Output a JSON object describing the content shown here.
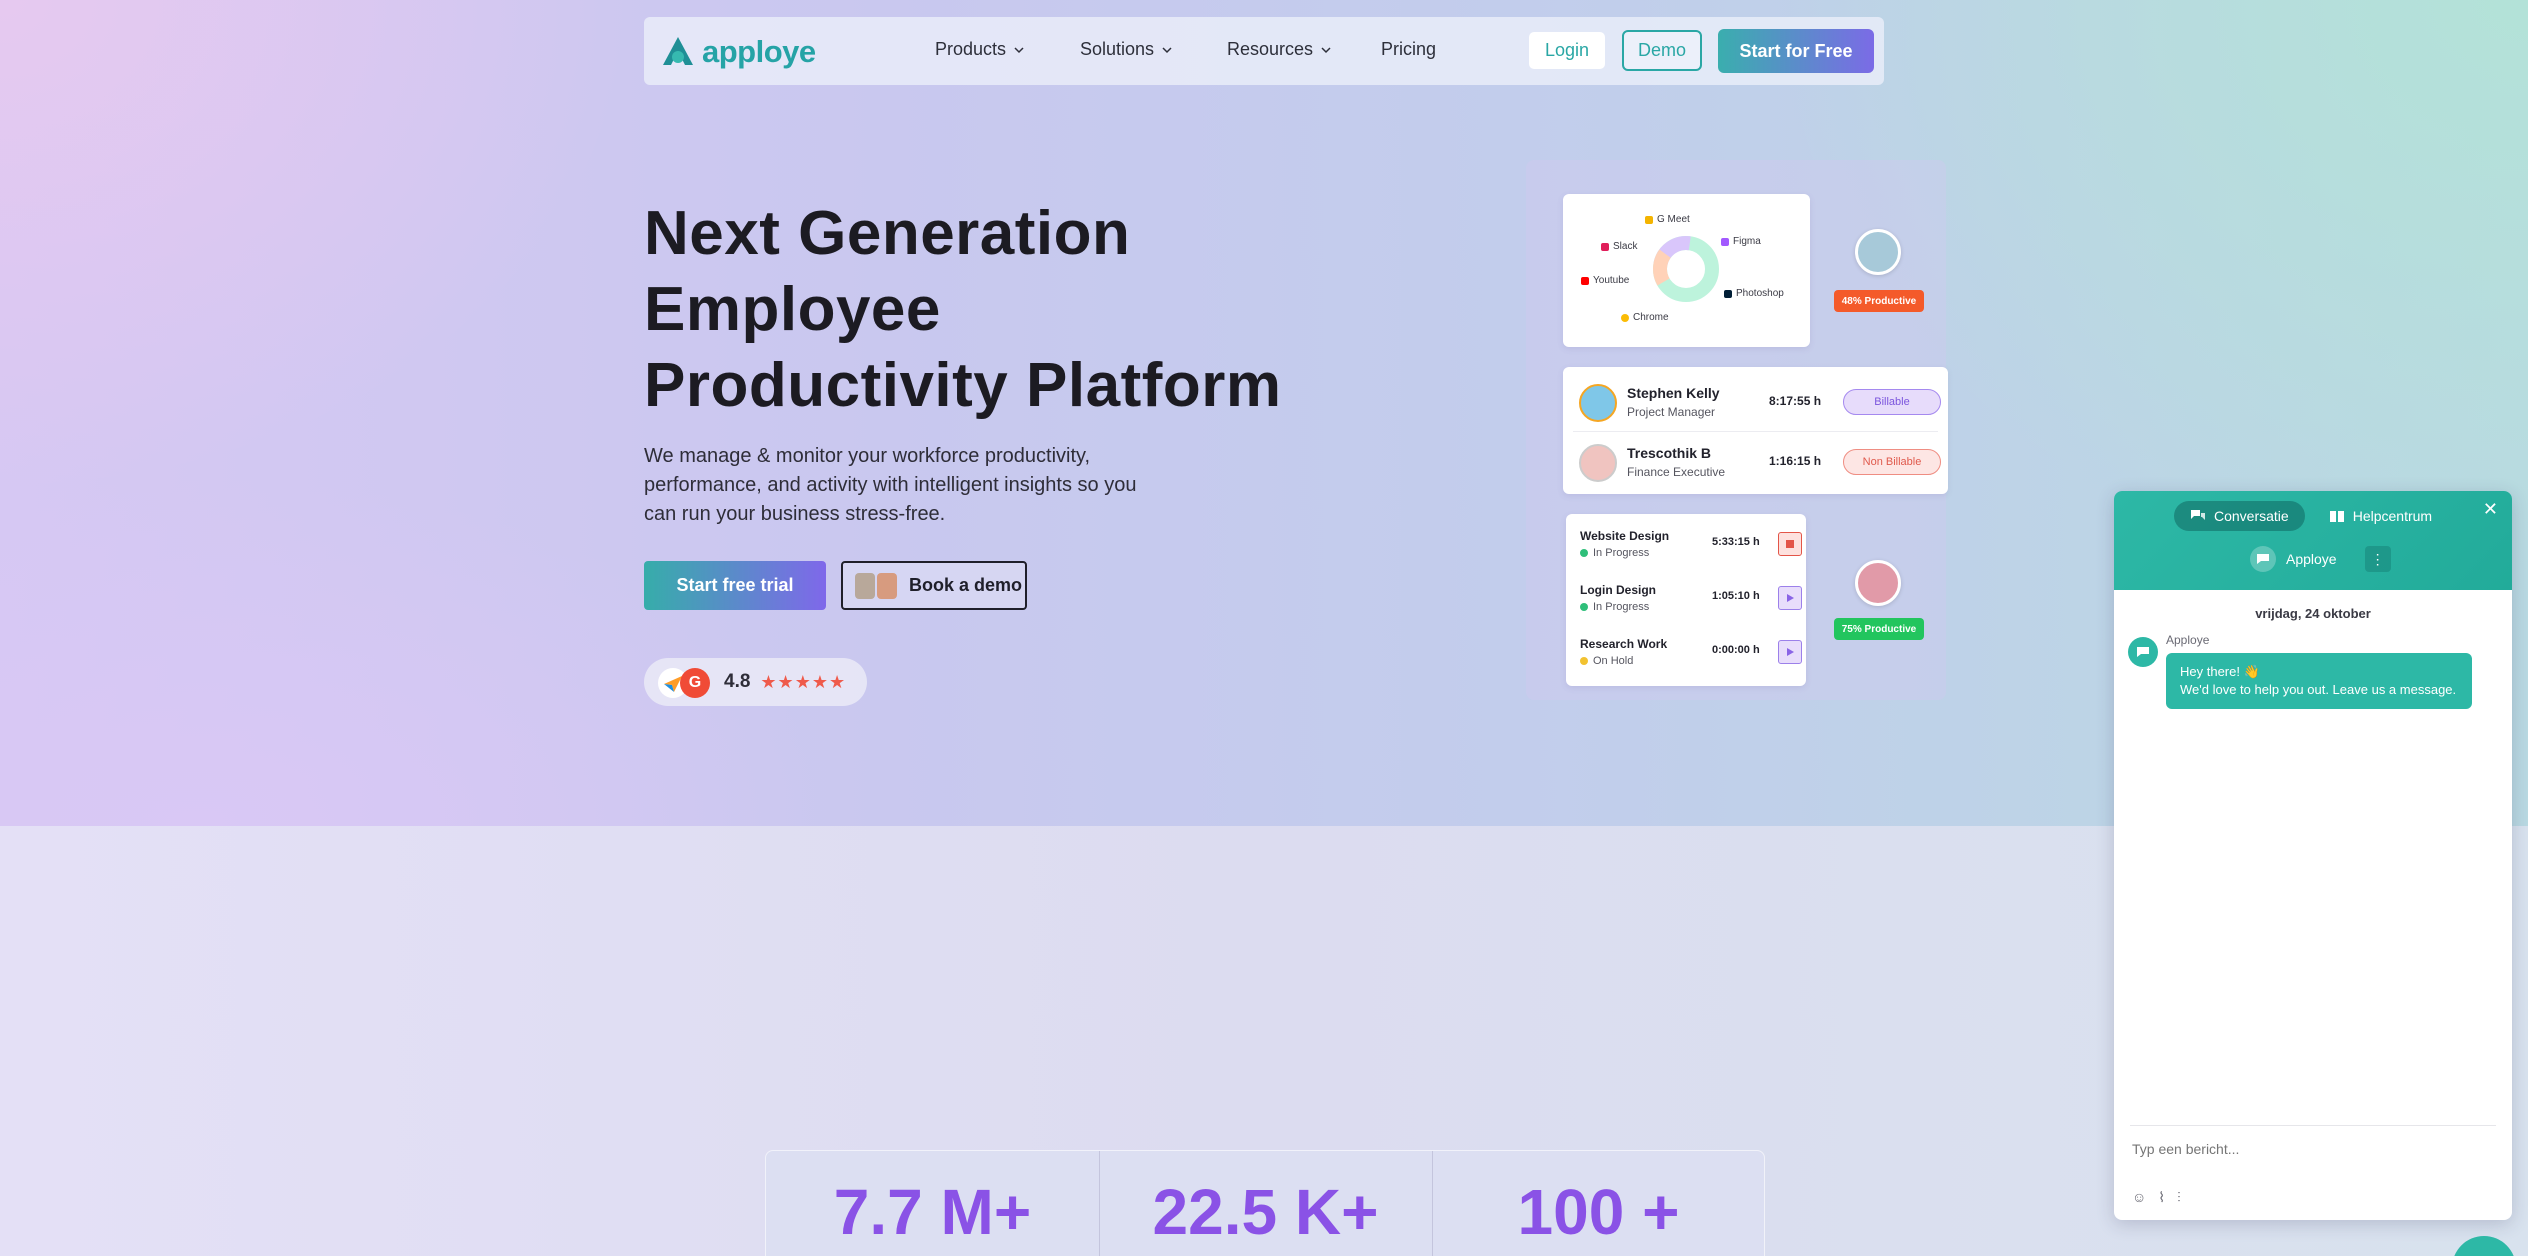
{
  "nav": {
    "logo_text": "apploye",
    "items": [
      {
        "label": "Products",
        "has_dropdown": true
      },
      {
        "label": "Solutions",
        "has_dropdown": true
      },
      {
        "label": "Resources",
        "has_dropdown": true
      },
      {
        "label": "Pricing",
        "has_dropdown": false
      }
    ],
    "login_label": "Login",
    "demo_label": "Demo",
    "start_label": "Start for Free"
  },
  "hero": {
    "title_line1": "Next Generation",
    "title_line2": "Employee",
    "title_line3": "Productivity Platform",
    "subtitle": "We manage & monitor your workforce productivity, performance, and activity with intelligent insights so you can run your business stress-free.",
    "trial_label": "Start free trial",
    "demo_label": "Book a demo",
    "rating_value": "4.8",
    "rating_stars": "★★★★★"
  },
  "apps_card": {
    "apps": [
      {
        "name": "G Meet",
        "color": "#f4b400"
      },
      {
        "name": "Figma",
        "color": "#a259ff"
      },
      {
        "name": "Slack",
        "color": "#e01e5a"
      },
      {
        "name": "Youtube",
        "color": "#ff0000"
      },
      {
        "name": "Photoshop",
        "color": "#001e36"
      },
      {
        "name": "Chrome",
        "color": "#fbbc05"
      }
    ],
    "productive_badge_1": "48% Productive",
    "productive_badge_2": "75% Productive"
  },
  "people": [
    {
      "name": "Stephen Kelly",
      "role": "Project Manager",
      "time": "8:17:55 h",
      "tag": "Billable"
    },
    {
      "name": "Trescothik B",
      "role": "Finance Executive",
      "time": "1:16:15 h",
      "tag": "Non Billable"
    }
  ],
  "tasks": [
    {
      "name": "Website Design",
      "status": "In Progress",
      "status_color": "#2fbf7a",
      "time": "5:33:15 h",
      "state": "stop"
    },
    {
      "name": "Login Design",
      "status": "In Progress",
      "status_color": "#2fbf7a",
      "time": "1:05:10 h",
      "state": "play"
    },
    {
      "name": "Research Work",
      "status": "On Hold",
      "status_color": "#f2c230",
      "time": "0:00:00 h",
      "state": "play"
    }
  ],
  "stats": [
    "7.7 M+",
    "22.5 K+",
    "100 +"
  ],
  "chat": {
    "tab_conversation": "Conversatie",
    "tab_help": "Helpcentrum",
    "agent_name": "Apploye",
    "date": "vrijdag, 24 oktober",
    "sender": "Apploye",
    "message_line1": "Hey there! 👋",
    "message_line2": "We'd love to help you out. Leave us a message.",
    "input_placeholder": "Typ een bericht..."
  },
  "colors": {
    "brand_teal": "#2aa7a5",
    "brand_purple": "#7b6be6",
    "stat_purple": "#8a52e6",
    "chat_teal": "#2db8a6"
  }
}
